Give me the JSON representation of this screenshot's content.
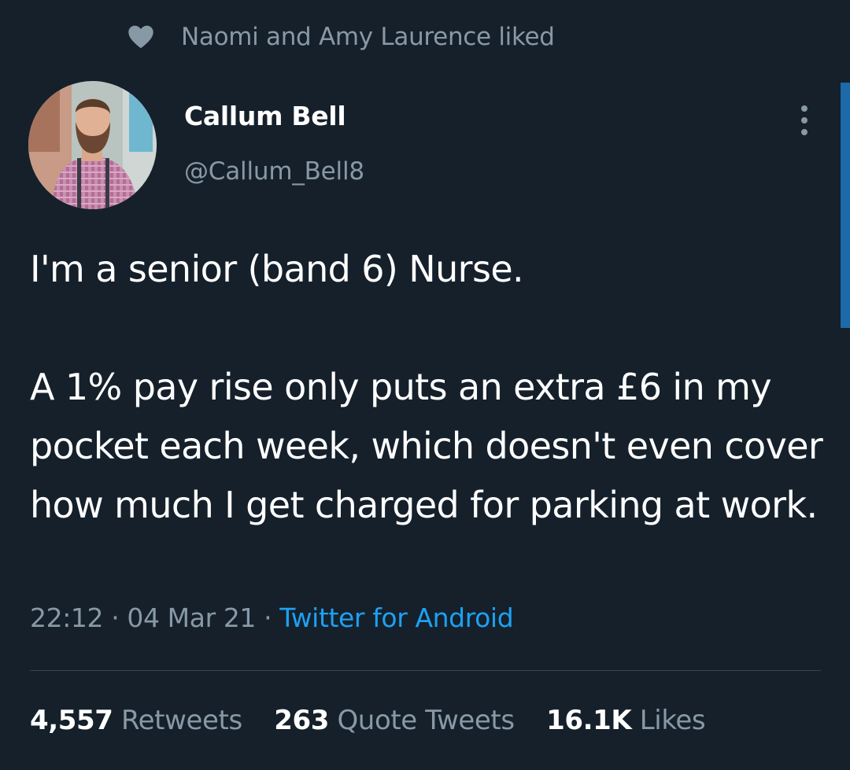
{
  "social_context": {
    "icon": "heart-icon",
    "text": "Naomi and Amy Laurence liked"
  },
  "author": {
    "display_name": "Callum Bell",
    "handle": "@Callum_Bell8",
    "avatar": "profile photo of bearded man in checked shirt with braces"
  },
  "tweet": {
    "text": "I'm a senior (band 6) Nurse.\n\nA 1% pay rise only puts an extra £6 in my pocket each week, which doesn't even cover how much I get charged for parking at work.",
    "time": "22:12",
    "separator": " · ",
    "date": "04 Mar 21",
    "source": "Twitter for Android"
  },
  "stats": {
    "retweets_count": "4,557",
    "retweets_label": "Retweets",
    "quotes_count": "263",
    "quotes_label": "Quote Tweets",
    "likes_count": "16.1K",
    "likes_label": "Likes"
  },
  "colors": {
    "background": "#15202b",
    "text_primary": "#ffffff",
    "text_secondary": "#8899a6",
    "link": "#1da1f2",
    "divider": "#38444d"
  }
}
